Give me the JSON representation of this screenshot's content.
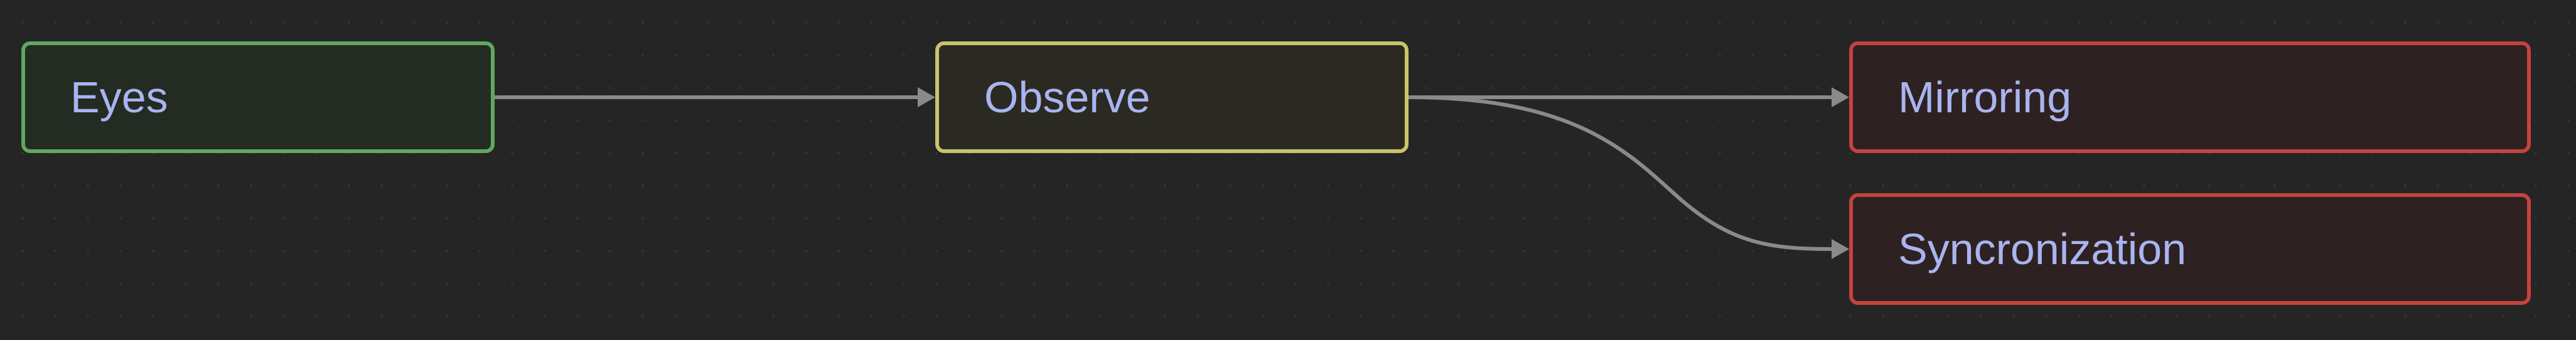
{
  "colors": {
    "background": "#252525",
    "label": "#a9b4f0",
    "edge": "#8a8a8a"
  },
  "nodes": {
    "eyes": {
      "label": "Eyes",
      "border": "#5fa85f",
      "fill": "#232b23"
    },
    "observe": {
      "label": "Observe",
      "border": "#c9c46a",
      "fill": "#2b2a22"
    },
    "mirroring": {
      "label": "Mirroring",
      "border": "#c4433f",
      "fill": "#2e2121"
    },
    "syncronization": {
      "label": "Syncronization",
      "border": "#c4433f",
      "fill": "#2e2121"
    }
  },
  "edges": [
    {
      "from": "eyes",
      "to": "observe"
    },
    {
      "from": "observe",
      "to": "mirroring"
    },
    {
      "from": "observe",
      "to": "syncronization"
    }
  ]
}
